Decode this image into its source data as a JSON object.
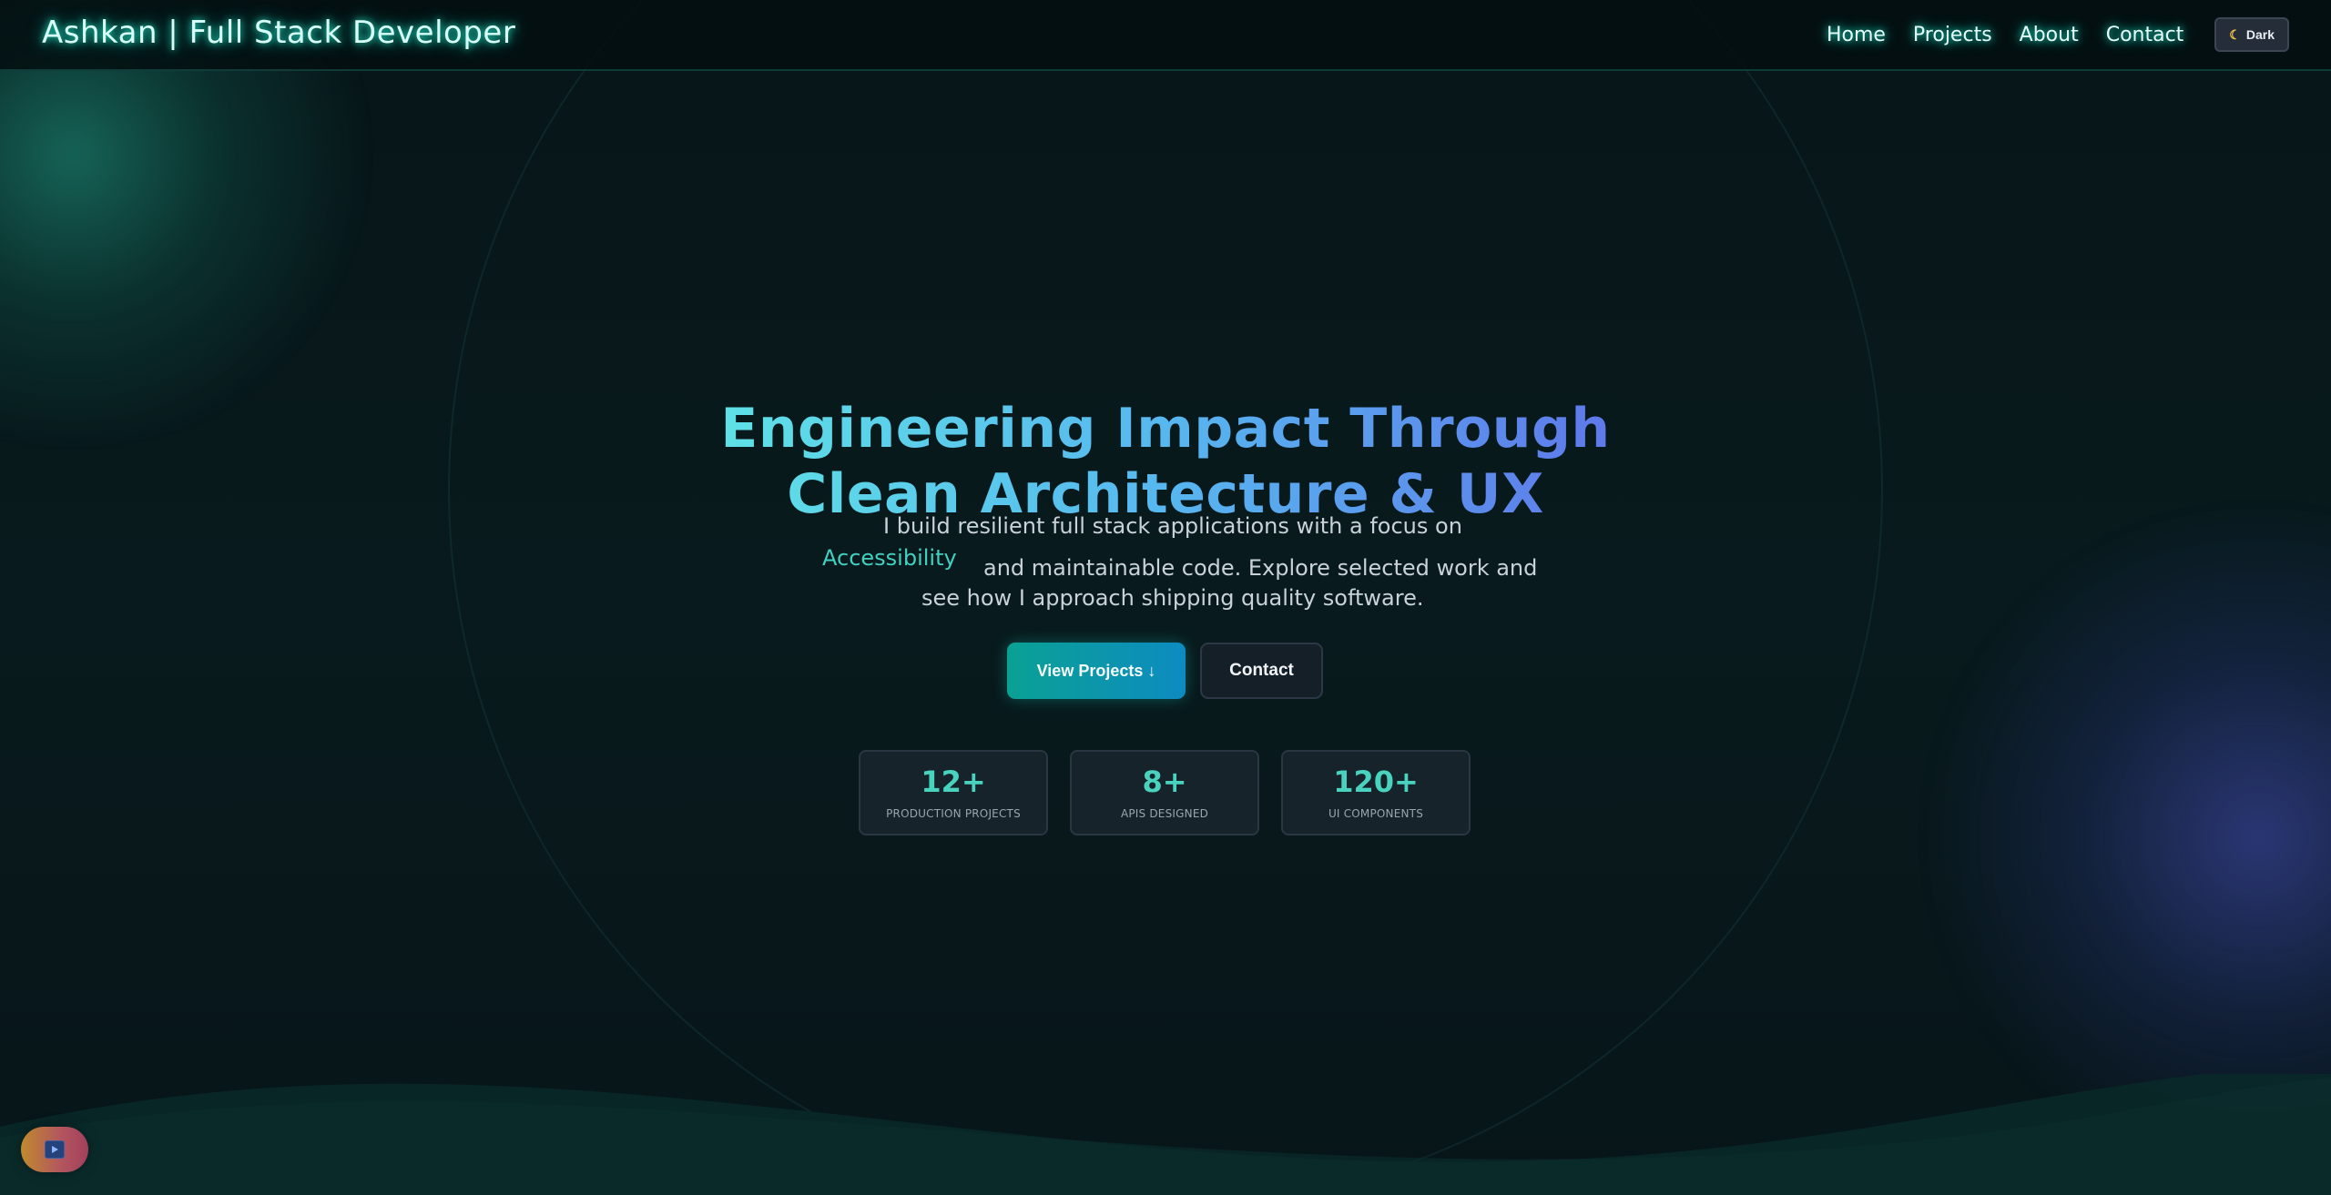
{
  "header": {
    "brand": "Ashkan | Full Stack Developer",
    "nav": [
      "Home",
      "Projects",
      "About",
      "Contact"
    ],
    "theme_toggle": {
      "icon": "moon-icon",
      "label": "Dark"
    }
  },
  "hero": {
    "title": "Engineering Impact Through\nClean Architecture & UX",
    "lead_line_1": "I build resilient full stack applications with a focus on",
    "rotating_word": "Accessibility",
    "lead_line_2": "and maintainable code. Explore selected work and",
    "lead_line_3": "see how I approach shipping quality software.",
    "primary_cta": "View Projects ↓",
    "secondary_cta": "Contact"
  },
  "stats": [
    {
      "value": "12+",
      "label": "PRODUCTION PROJECTS"
    },
    {
      "value": "8+",
      "label": "APIS DESIGNED"
    },
    {
      "value": "120+",
      "label": "UI COMPONENTS"
    }
  ],
  "media_button": {
    "icon": "play-video-icon"
  },
  "colors": {
    "accent": "#49d3bf",
    "gradient_start": "#5fe1e6",
    "gradient_end": "#5f77ea",
    "background": "#071618"
  }
}
